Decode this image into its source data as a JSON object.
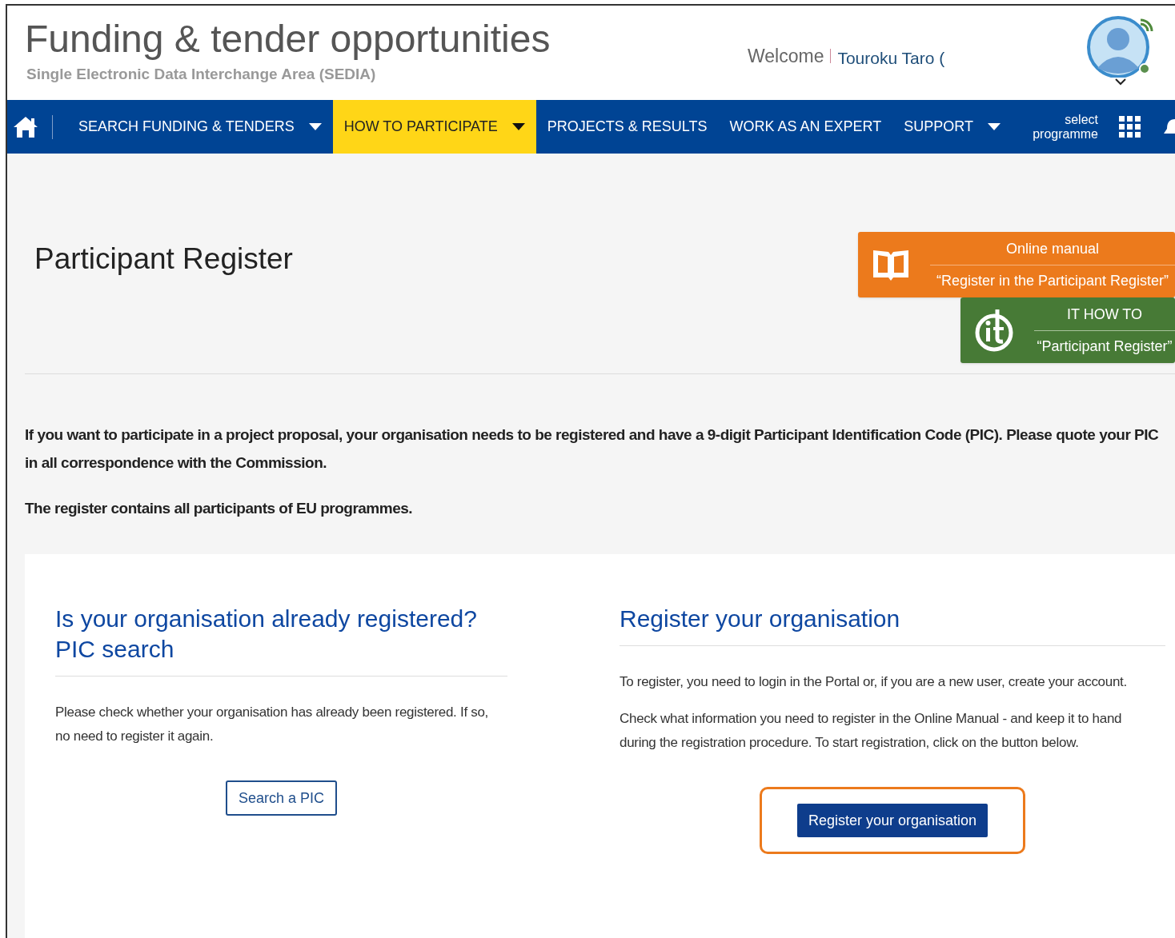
{
  "header": {
    "title": "Funding & tender opportunities",
    "subtitle": "Single Electronic Data Interchange Area (SEDIA)",
    "welcome": "Welcome",
    "user_name": "Touroku Taro ("
  },
  "nav": {
    "items": [
      {
        "label": "SEARCH FUNDING & TENDERS",
        "dropdown": true,
        "selected": false
      },
      {
        "label": "HOW TO PARTICIPATE",
        "dropdown": true,
        "selected": true
      },
      {
        "label": "PROJECTS & RESULTS",
        "dropdown": false,
        "selected": false
      },
      {
        "label": "WORK AS AN EXPERT",
        "dropdown": false,
        "selected": false
      },
      {
        "label": "SUPPORT",
        "dropdown": true,
        "selected": false
      }
    ],
    "programme_select": [
      "select",
      "programme"
    ]
  },
  "page": {
    "title": "Participant Register",
    "guides": [
      {
        "kind": "manual",
        "title": "Online manual",
        "subtitle": "“Register in the Participant Register”"
      },
      {
        "kind": "it",
        "title": "IT HOW TO",
        "subtitle": "“Participant Register”"
      }
    ],
    "intro": [
      "If you want to participate in a project proposal, your organisation needs to be registered and have a 9-digit Participant Identification Code (PIC). Please quote your PIC in all correspondence with the Commission.",
      "The register contains all participants of EU programmes."
    ],
    "panels": [
      {
        "heading": [
          "Is your organisation already registered?",
          "PIC search"
        ],
        "paragraphs": [
          "Please check whether your organisation has already been registered. If so, no need to register it again."
        ],
        "button": {
          "label": "Search a PIC",
          "kind": "outline",
          "highlighted": false
        }
      },
      {
        "heading": [
          "Register your organisation"
        ],
        "paragraphs": [
          "To register, you need to login in the Portal or, if you are a new user, create your account.",
          "Check what information you need to register in the Online Manual - and keep it to hand during the registration procedure. To start registration, click on the button below."
        ],
        "button": {
          "label": "Register your organisation",
          "kind": "solid",
          "highlighted": true
        }
      }
    ]
  }
}
